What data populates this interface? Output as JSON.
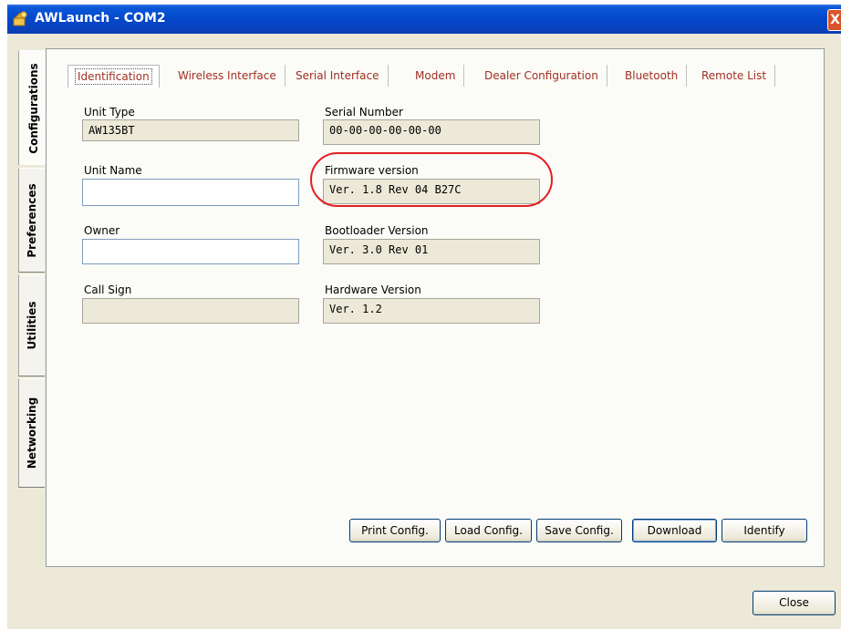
{
  "window": {
    "title": "AWLaunch - COM2",
    "close_glyph": "X"
  },
  "side_tabs": [
    {
      "label": "Configurations",
      "active": true
    },
    {
      "label": "Preferences",
      "active": false
    },
    {
      "label": "Utilities",
      "active": false
    },
    {
      "label": "Networking",
      "active": false
    }
  ],
  "top_tabs": [
    {
      "label": "Identification",
      "active": true
    },
    {
      "label": "Wireless Interface"
    },
    {
      "label": "Serial Interface"
    },
    {
      "label": "Modem"
    },
    {
      "label": "Dealer Configuration"
    },
    {
      "label": "Bluetooth"
    },
    {
      "label": "Remote List"
    }
  ],
  "fields": {
    "unit_type": {
      "label": "Unit Type",
      "value": "AW135BT"
    },
    "unit_name": {
      "label": "Unit Name",
      "value": ""
    },
    "owner": {
      "label": "Owner",
      "value": ""
    },
    "call_sign": {
      "label": "Call Sign",
      "value": ""
    },
    "serial_number": {
      "label": "Serial Number",
      "value": "00-00-00-00-00-00"
    },
    "firmware_version": {
      "label": "Firmware version",
      "value": "Ver. 1.8 Rev 04 B27C"
    },
    "bootloader_version": {
      "label": "Bootloader Version",
      "value": "Ver. 3.0 Rev 01"
    },
    "hardware_version": {
      "label": "Hardware Version",
      "value": "Ver. 1.2"
    }
  },
  "buttons": {
    "print": "Print Config.",
    "load": "Load Config.",
    "save": "Save Config.",
    "download": "Download",
    "identify": "Identify",
    "close": "Close"
  },
  "colors": {
    "titlebar": "#0446c9",
    "tab_text": "#a03020",
    "highlight": "#e02020"
  }
}
